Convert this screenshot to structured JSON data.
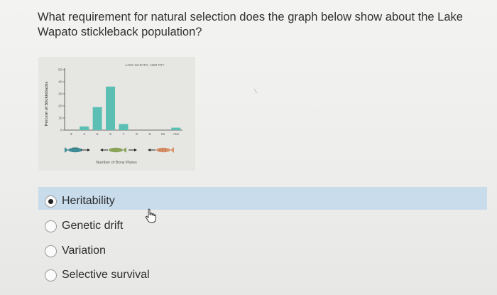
{
  "question": {
    "text": "What requirement for natural selection does the graph below show about the Lake Wapato stickleback population?"
  },
  "chart_data": {
    "type": "bar",
    "title": "LAKE WAPATO, 1968 FRY",
    "xlabel": "Number of Bony Plates",
    "ylabel": "Percent of Sticklebacks",
    "categories": [
      "3",
      "4",
      "5",
      "6",
      "7",
      "8",
      "9",
      "10",
      ">10"
    ],
    "values": [
      0,
      3,
      19,
      36,
      5,
      0,
      0,
      0,
      2
    ],
    "y_ticks": [
      "0",
      "10",
      "20",
      "30",
      "40",
      "50"
    ],
    "ylim": [
      0,
      50
    ],
    "grid": false,
    "bar_color": "#5bbfb3"
  },
  "options": [
    {
      "label": "Heritability",
      "selected": true
    },
    {
      "label": "Genetic drift",
      "selected": false
    },
    {
      "label": "Variation",
      "selected": false
    },
    {
      "label": "Selective survival",
      "selected": false
    }
  ],
  "colors": {
    "highlight": "#c8dcec",
    "text": "#303030",
    "bar": "#5bbfb3"
  },
  "icons": {
    "cursor": "hand-pointer-icon",
    "radio_selected": "radio-checked-icon",
    "radio_unselected": "radio-empty-icon"
  }
}
